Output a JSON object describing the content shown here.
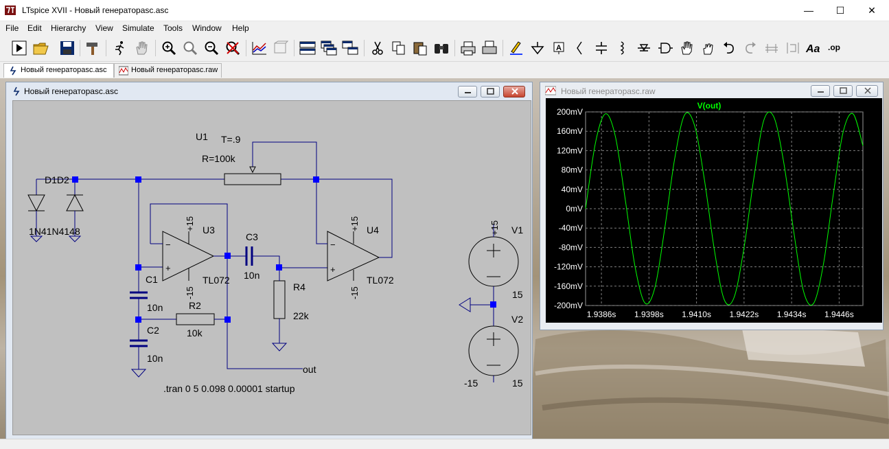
{
  "window": {
    "title": "LTspice XVII - Новый генераторasc.asc",
    "minimize_glyph": "—",
    "maximize_glyph": "☐",
    "close_glyph": "✕"
  },
  "menu": [
    "File",
    "Edit",
    "Hierarchy",
    "View",
    "Simulate",
    "Tools",
    "Window",
    "Help"
  ],
  "tabs": [
    {
      "label": "Новый генераторasc.asc",
      "icon": "schematic-icon",
      "active": true
    },
    {
      "label": "Новый генераторasc.raw",
      "icon": "waveform-icon",
      "active": false
    }
  ],
  "schematic_window": {
    "title": "Новый генераторasc.asc",
    "labels": {
      "u1": "U1",
      "u1_t": "T=.9",
      "u1_r": "R=100k",
      "d1d2": "D1D2",
      "diodes": "1N41N4148",
      "u3": "U3",
      "u3_model": "TL072",
      "u3_vp": "+15",
      "u3_vn": "-15",
      "u4": "U4",
      "u4_model": "TL072",
      "u4_vp": "+15",
      "u4_vn": "-15",
      "c1": "C1",
      "c1_val": "10n",
      "c2": "C2",
      "c2_val": "10n",
      "c3": "C3",
      "c3_val": "10n",
      "r2": "R2",
      "r2_val": "10k",
      "r4": "R4",
      "r4_val": "22k",
      "out": "out",
      "v1": "V1",
      "v1_top": "+15",
      "v1_val": "15",
      "v2": "V2",
      "v2_val": "15",
      "v2_bottom": "-15",
      "directive": ".tran 0 5 0.098 0.00001 startup"
    }
  },
  "waveform_window": {
    "title": "Новый генераторasc.raw"
  },
  "chart_data": {
    "type": "line",
    "title": "V(out)",
    "series": [
      {
        "name": "V(out)",
        "color": "#00ff00",
        "x": [
          1.9382,
          1.93845,
          1.9387,
          1.93895,
          1.9392,
          1.93945,
          1.9397,
          1.93995,
          1.9402,
          1.94045,
          1.9407,
          1.94095,
          1.9412,
          1.94145,
          1.9417,
          1.94195,
          1.9422,
          1.94245,
          1.9427,
          1.94295,
          1.9432,
          1.94345,
          1.9437,
          1.94395,
          1.9442,
          1.94445,
          1.9447,
          1.94495,
          1.9452
        ],
        "y": [
          0,
          136,
          196,
          150,
          20,
          -120,
          -195,
          -163,
          -40,
          104,
          194,
          172,
          60,
          -85,
          -188,
          -183,
          -80,
          65,
          183,
          190,
          96,
          -45,
          -170,
          -196,
          -116,
          28,
          158,
          196,
          130
        ]
      }
    ],
    "x_ticks": [
      "1.9386s",
      "1.9398s",
      "1.9410s",
      "1.9422s",
      "1.9434s",
      "1.9446s"
    ],
    "y_ticks": [
      "200mV",
      "160mV",
      "120mV",
      "80mV",
      "40mV",
      "0mV",
      "-40mV",
      "-80mV",
      "-120mV",
      "-160mV",
      "-200mV"
    ],
    "xlim": [
      1.9382,
      1.9452
    ],
    "ylim": [
      -200,
      200
    ],
    "yunit": "mV",
    "grid": true
  }
}
